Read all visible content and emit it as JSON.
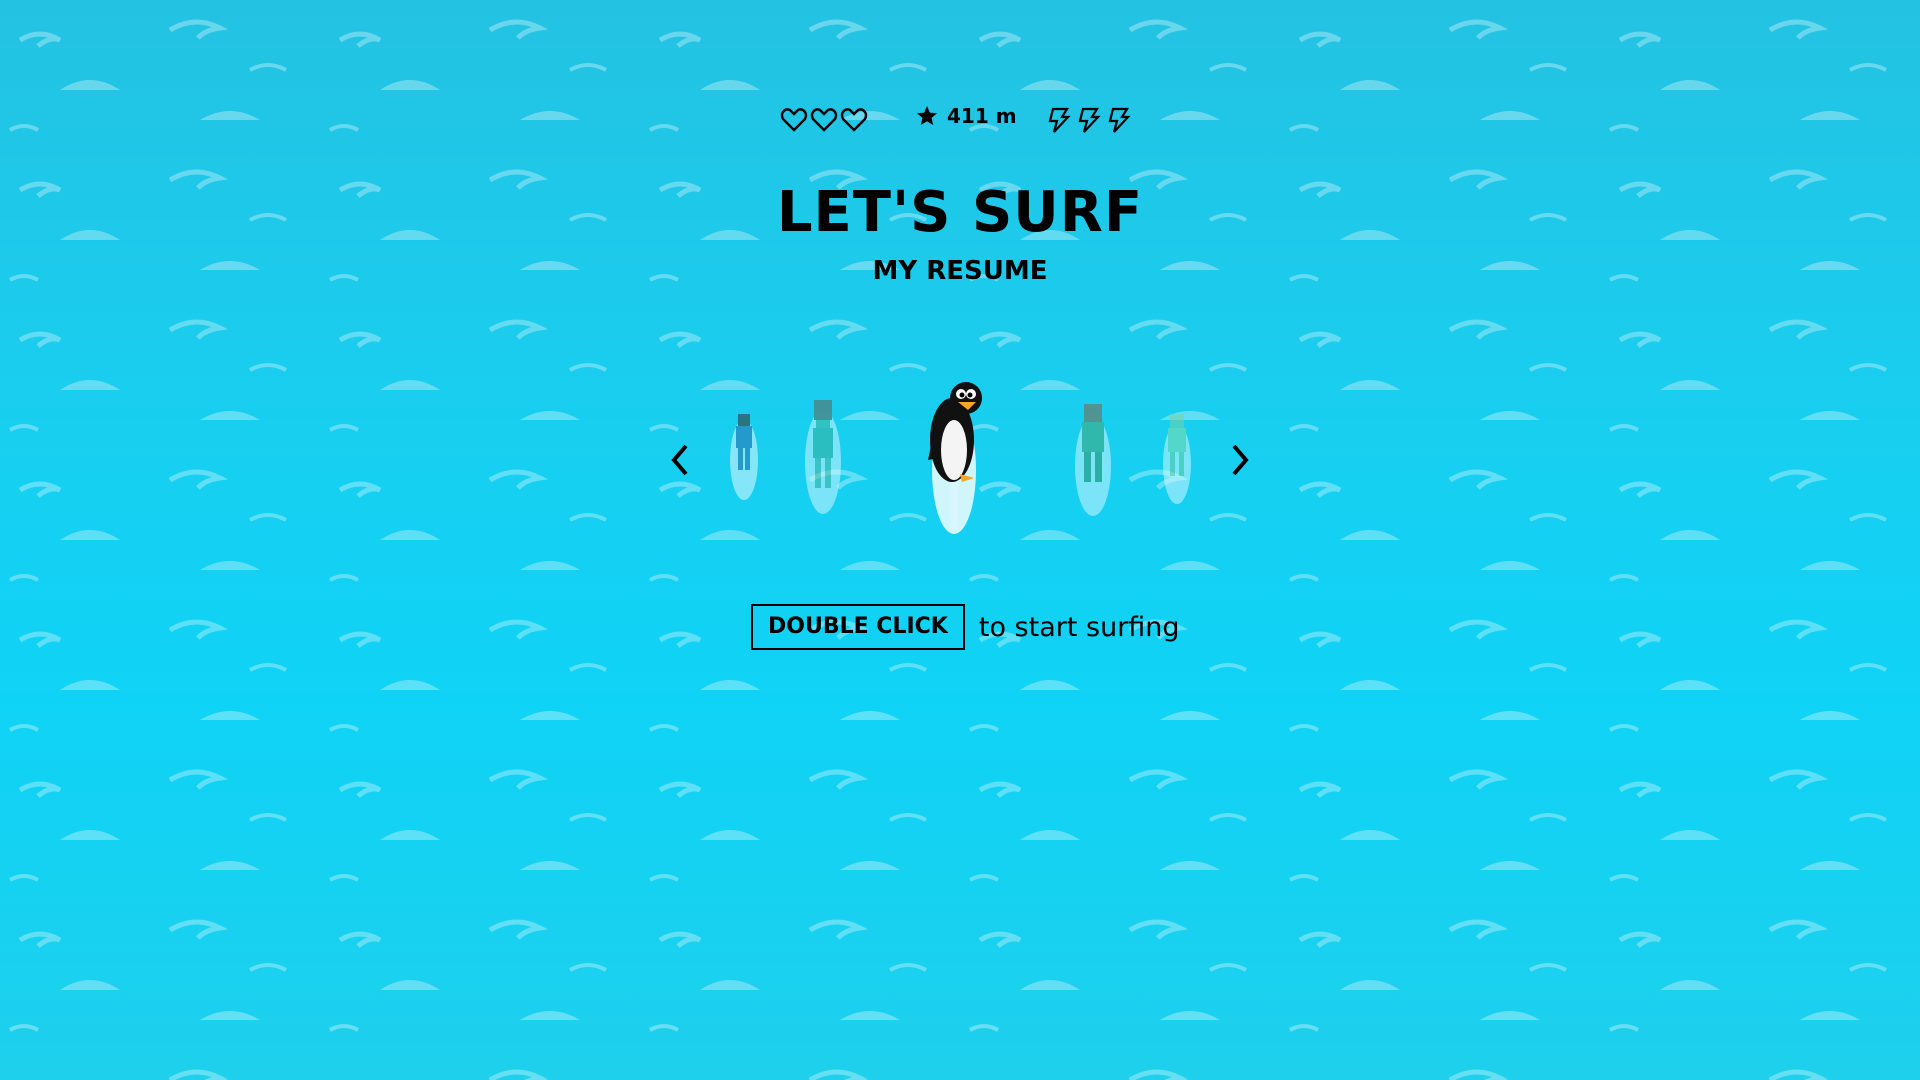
{
  "hud": {
    "lives_total": 3,
    "lives_icon": "heart-outline-icon",
    "distance_icon": "star-icon",
    "distance": "411 m",
    "boosts_total": 3,
    "boosts_icon": "lightning-bolt-icon"
  },
  "title": "LET'S SURF",
  "subtitle": "MY RESUME",
  "carousel": {
    "prev_icon": "chevron-left-icon",
    "next_icon": "chevron-right-icon",
    "characters": [
      "surfer-boy",
      "surfer-girl",
      "penguin",
      "surfer-man",
      "surfer-kid"
    ],
    "selected": "penguin"
  },
  "cta": {
    "button_label": "DOUBLE CLICK",
    "hint": "to start surfing"
  },
  "colors": {
    "water_top": "#24c2e2",
    "water_mid": "#0fd3f6",
    "text": "#000000"
  }
}
